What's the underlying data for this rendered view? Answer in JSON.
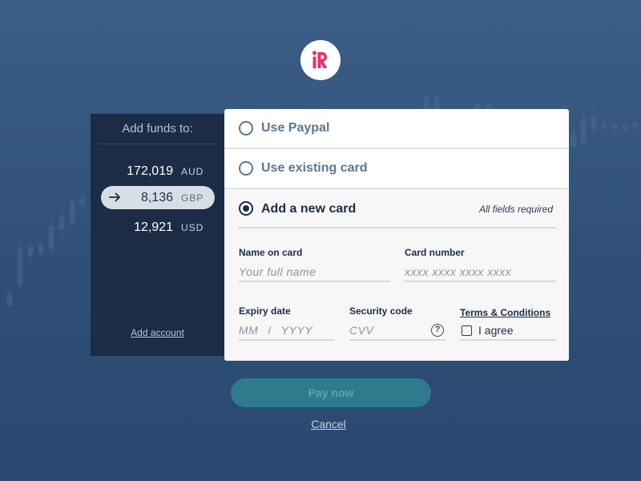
{
  "logo": {
    "letter": "R",
    "brand_color": "#e8306a"
  },
  "accounts": {
    "title": "Add funds to:",
    "items": [
      {
        "amount": "172,019",
        "currency": "AUD",
        "selected": false
      },
      {
        "amount": "8,136",
        "currency": "GBP",
        "selected": true
      },
      {
        "amount": "12,921",
        "currency": "USD",
        "selected": false
      }
    ],
    "add_account_label": "Add account"
  },
  "payment": {
    "options": [
      {
        "label": "Use Paypal",
        "checked": false
      },
      {
        "label": "Use existing card",
        "checked": false
      },
      {
        "label": "Add a new card",
        "checked": true
      }
    ],
    "required_note": "All fields required",
    "fields": {
      "name": {
        "label": "Name on card",
        "placeholder": "Your full name"
      },
      "number": {
        "label": "Card number",
        "placeholder": "xxxx xxxx xxxx xxxx"
      },
      "expiry": {
        "label": "Expiry date",
        "month_placeholder": "MM",
        "separator": "/",
        "year_placeholder": "YYYY"
      },
      "security": {
        "label": "Security code",
        "placeholder": "CVV",
        "help_glyph": "?"
      },
      "terms": {
        "link_label": "Terms & Conditions",
        "agree_label": "I agree",
        "checked": false
      }
    }
  },
  "actions": {
    "pay_label": "Pay now",
    "cancel_label": "Cancel"
  },
  "colors": {
    "panel": "#1c2c46",
    "accent": "#2f7b8e",
    "brand": "#e8306a"
  }
}
